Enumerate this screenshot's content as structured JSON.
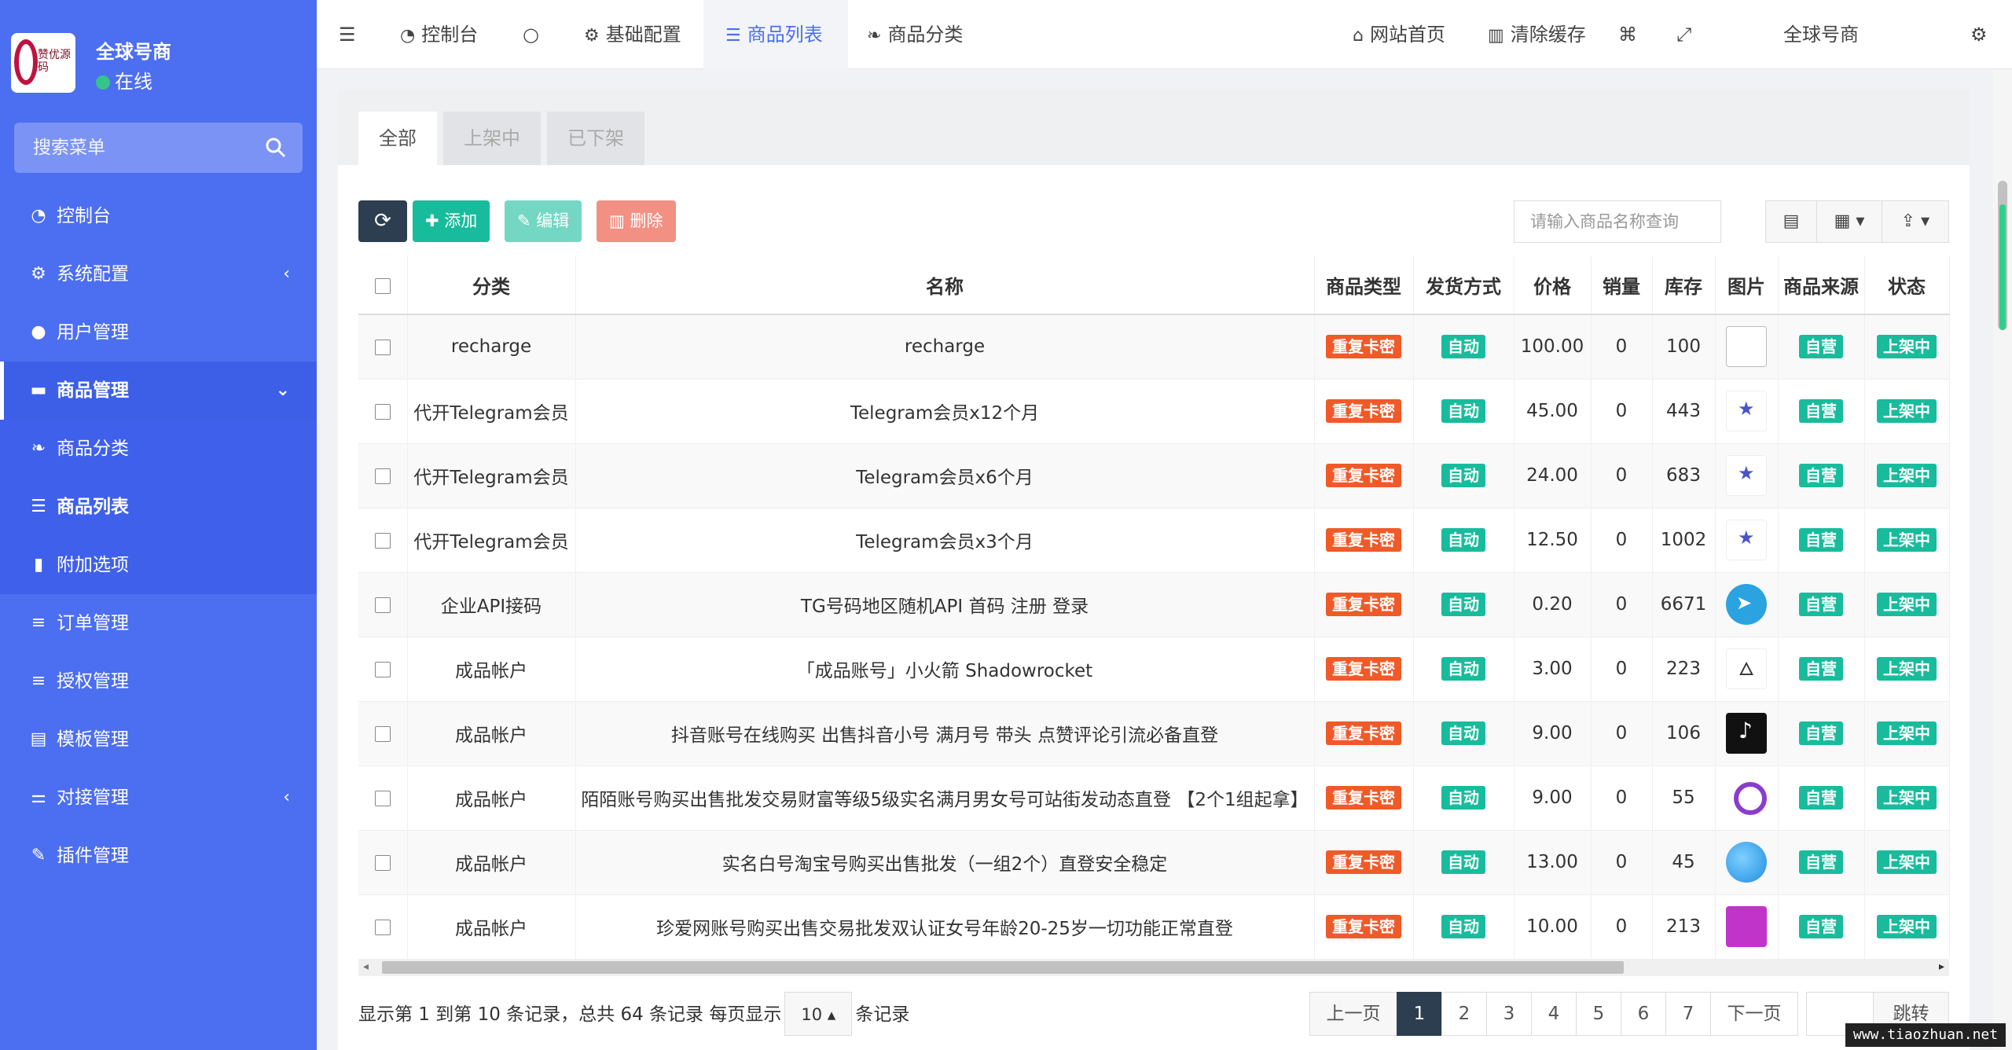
{
  "sidebar": {
    "brand_name": "全球号商",
    "logo_text": "赞优源码",
    "status": "在线",
    "search_placeholder": "搜索菜单",
    "items": [
      {
        "label": "控制台",
        "icon": "dashboard-icon"
      },
      {
        "label": "系统配置",
        "icon": "gear-icon"
      },
      {
        "label": "用户管理",
        "icon": "user-icon"
      },
      {
        "label": "商品管理",
        "icon": "cart-icon"
      },
      {
        "label": "商品分类",
        "icon": "leaf-icon"
      },
      {
        "label": "商品列表",
        "icon": "list-icon"
      },
      {
        "label": "附加选项",
        "icon": "bookmark-icon"
      },
      {
        "label": "订单管理",
        "icon": "bars-icon"
      },
      {
        "label": "授权管理",
        "icon": "bars-icon"
      },
      {
        "label": "模板管理",
        "icon": "template-icon"
      },
      {
        "label": "对接管理",
        "icon": "sliders-icon"
      },
      {
        "label": "插件管理",
        "icon": "wrench-icon"
      }
    ]
  },
  "topbar": {
    "tabs": [
      "控制台",
      "基础配置",
      "商品列表",
      "商品分类"
    ],
    "links": [
      "网站首页",
      "清除缓存"
    ],
    "user": "全球号商"
  },
  "content": {
    "tabs": [
      "全部",
      "上架中",
      "已下架"
    ],
    "toolbar": {
      "add": "添加",
      "edit": "编辑",
      "delete": "删除"
    },
    "search_placeholder": "请输入商品名称查询",
    "columns": [
      "分类",
      "名称",
      "商品类型",
      "发货方式",
      "价格",
      "销量",
      "库存",
      "图片",
      "商品来源",
      "状态"
    ],
    "rows": [
      {
        "category": "recharge",
        "name": "recharge",
        "type": "重复卡密",
        "delivery": "自动",
        "price": "100.00",
        "sales": "0",
        "stock": "100",
        "image": "broken",
        "source": "自营",
        "status": "上架中"
      },
      {
        "category": "代开Telegram会员",
        "name": "Telegram会员x12个月",
        "type": "重复卡密",
        "delivery": "自动",
        "price": "45.00",
        "sales": "0",
        "stock": "443",
        "image": "tg",
        "source": "自营",
        "status": "上架中"
      },
      {
        "category": "代开Telegram会员",
        "name": "Telegram会员x6个月",
        "type": "重复卡密",
        "delivery": "自动",
        "price": "24.00",
        "sales": "0",
        "stock": "683",
        "image": "tg",
        "source": "自营",
        "status": "上架中"
      },
      {
        "category": "代开Telegram会员",
        "name": "Telegram会员x3个月",
        "type": "重复卡密",
        "delivery": "自动",
        "price": "12.50",
        "sales": "0",
        "stock": "1002",
        "image": "tg",
        "source": "自营",
        "status": "上架中"
      },
      {
        "category": "企业API接码",
        "name": "TG号码地区随机API 首码 注册 登录",
        "type": "重复卡密",
        "delivery": "自动",
        "price": "0.20",
        "sales": "0",
        "stock": "6671",
        "image": "tgcircle",
        "source": "自营",
        "status": "上架中"
      },
      {
        "category": "成品帐户",
        "name": "「成品账号」小火箭 Shadowrocket",
        "type": "重复卡密",
        "delivery": "自动",
        "price": "3.00",
        "sales": "0",
        "stock": "223",
        "image": "rocket",
        "source": "自营",
        "status": "上架中"
      },
      {
        "category": "成品帐户",
        "name": "抖音账号在线购买 出售抖音小号 满月号 带头 点赞评论引流必备直登",
        "type": "重复卡密",
        "delivery": "自动",
        "price": "9.00",
        "sales": "0",
        "stock": "106",
        "image": "tiktok",
        "source": "自营",
        "status": "上架中"
      },
      {
        "category": "成品帐户",
        "name": "陌陌账号购买出售批发交易财富等级5级实名满月男女号可站街发动态直登 【2个1组起拿】",
        "type": "重复卡密",
        "delivery": "自动",
        "price": "9.00",
        "sales": "0",
        "stock": "55",
        "image": "momo",
        "source": "自营",
        "status": "上架中"
      },
      {
        "category": "成品帐户",
        "name": "实名白号淘宝号购买出售批发（一组2个）直登安全稳定",
        "type": "重复卡密",
        "delivery": "自动",
        "price": "13.00",
        "sales": "0",
        "stock": "45",
        "image": "blue",
        "source": "自营",
        "status": "上架中"
      },
      {
        "category": "成品帐户",
        "name": "珍爱网账号购买出售交易批发双认证女号年龄20-25岁一切功能正常直登",
        "type": "重复卡密",
        "delivery": "自动",
        "price": "10.00",
        "sales": "0",
        "stock": "213",
        "image": "zhen",
        "source": "自营",
        "status": "上架中"
      }
    ],
    "pagination": {
      "info_prefix": "显示第 1 到第 10 条记录，总共 64 条记录 每页显示",
      "page_size": "10",
      "info_suffix": "条记录",
      "prev": "上一页",
      "next": "下一页",
      "pages": [
        "1",
        "2",
        "3",
        "4",
        "5",
        "6",
        "7"
      ],
      "current": "1",
      "jump": "跳转"
    }
  },
  "watermark": "www.tiaozhuan.net",
  "colors": {
    "sidebar": "#4c6ef0",
    "accent": "#18bc9c",
    "danger": "#f05a28",
    "dark": "#2c3e50"
  }
}
